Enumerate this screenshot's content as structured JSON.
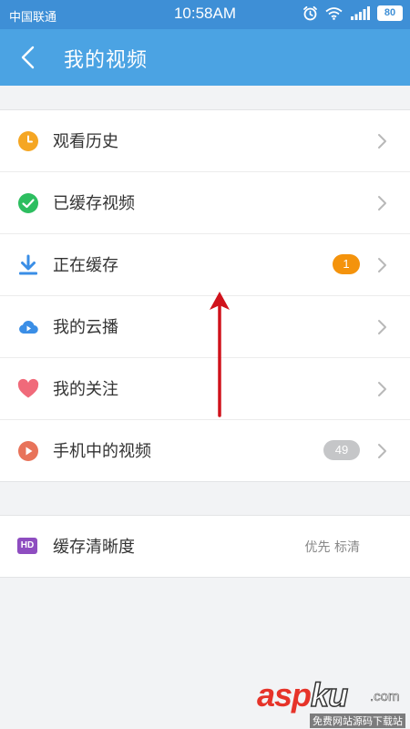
{
  "status_bar": {
    "carrier": "中国联通",
    "time": "10:58AM",
    "battery": "80",
    "icons": [
      "alarm-icon",
      "wifi-icon",
      "signal-icon",
      "battery-icon"
    ]
  },
  "nav": {
    "title": "我的视频",
    "back_icon": "back-chevron-icon"
  },
  "menu": [
    {
      "label": "观看历史",
      "icon": "clock-icon",
      "color": "#f5a623"
    },
    {
      "label": "已缓存视频",
      "icon": "check-circle-icon",
      "color": "#2dbe60"
    },
    {
      "label": "正在缓存",
      "icon": "download-icon",
      "color": "#3a8ee6",
      "badge": "1"
    },
    {
      "label": "我的云播",
      "icon": "cloud-play-icon",
      "color": "#3a8ee6"
    },
    {
      "label": "我的关注",
      "icon": "heart-icon",
      "color": "#f06a7a"
    },
    {
      "label": "手机中的视频",
      "icon": "play-circle-icon",
      "color": "#e8735a",
      "badge": "49"
    }
  ],
  "settings": {
    "label": "缓存清晰度",
    "icon_text": "HD",
    "value": "优先 标清"
  },
  "watermark": {
    "brand_asp": "asp",
    "brand_ku": "ku",
    "domain": ".com",
    "sub": "免费网站源码下载站"
  },
  "colors": {
    "status_bar": "#3e8fd6",
    "nav_bar": "#4ba3e3",
    "annotation_arrow": "#d0121b",
    "hd_icon": "#8e4dc0"
  }
}
